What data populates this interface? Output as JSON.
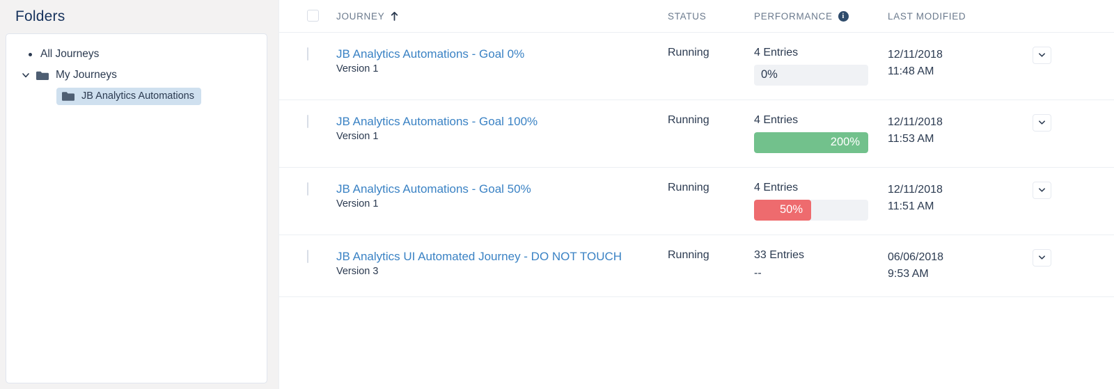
{
  "sidebar": {
    "title": "Folders",
    "items": [
      {
        "label": "All Journeys",
        "icon": "bullet-dot",
        "level": 0,
        "selected": false
      },
      {
        "label": "My Journeys",
        "icon": "open-folder-icon",
        "level": 1,
        "selected": false
      },
      {
        "label": "JB Analytics Automations",
        "icon": "folder-icon",
        "level": 2,
        "selected": true
      }
    ]
  },
  "table": {
    "columns": {
      "journey": "JOURNEY",
      "status": "STATUS",
      "performance": "PERFORMANCE",
      "last_modified": "LAST MODIFIED"
    },
    "sort": {
      "column": "JOURNEY",
      "direction": "asc",
      "icon": "sort-asc-arrow-icon"
    },
    "performance_info_icon": "info-icon",
    "select_all_checkbox": false,
    "rows": [
      {
        "name": "JB Analytics Automations - Goal 0%",
        "version": "Version 1",
        "status": "Running",
        "entries": "4 Entries",
        "performance_label": "0%",
        "performance_percent": 0,
        "performance_state": "empty",
        "date": "12/11/2018",
        "time": "11:48 AM",
        "checked": false,
        "action_icon": "chevron-down-icon"
      },
      {
        "name": "JB Analytics Automations - Goal 100%",
        "version": "Version 1",
        "status": "Running",
        "entries": "4 Entries",
        "performance_label": "200%",
        "performance_percent": 100,
        "performance_state": "success",
        "date": "12/11/2018",
        "time": "11:53 AM",
        "checked": false,
        "action_icon": "chevron-down-icon"
      },
      {
        "name": "JB Analytics Automations - Goal 50%",
        "version": "Version 1",
        "status": "Running",
        "entries": "4 Entries",
        "performance_label": "50%",
        "performance_percent": 50,
        "performance_state": "danger",
        "date": "12/11/2018",
        "time": "11:51 AM",
        "checked": false,
        "action_icon": "chevron-down-icon"
      },
      {
        "name": "JB Analytics UI Automated Journey - DO NOT TOUCH",
        "version": "Version 3",
        "status": "Running",
        "entries": "33 Entries",
        "performance_label": "--",
        "performance_percent": null,
        "performance_state": "none",
        "date": "06/06/2018",
        "time": "9:53 AM",
        "checked": false,
        "action_icon": "chevron-down-icon"
      }
    ]
  },
  "colors": {
    "link": "#3a82c4",
    "success_bar": "#72c18c",
    "danger_bar": "#ee6b6e",
    "track": "#f0f2f5",
    "selected_folder": "#cfe0ef",
    "text": "#2b3a50",
    "header_text": "#6b7a8d",
    "page_bg": "#f3f2f2"
  }
}
